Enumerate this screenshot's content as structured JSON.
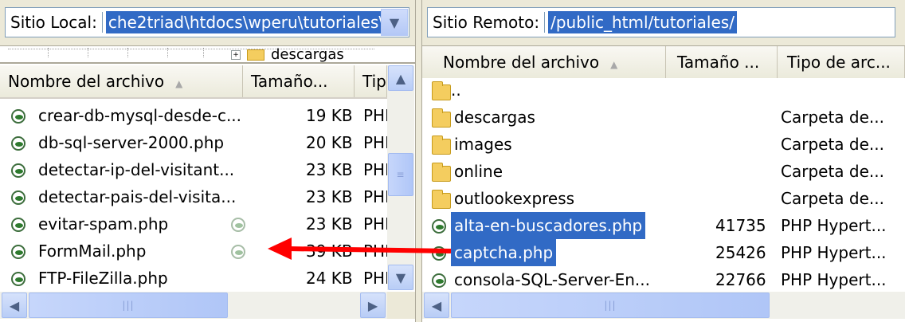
{
  "local": {
    "path_label": "Sitio Local:",
    "path_value": "che2triad\\htdocs\\wperu\\tutoriales\\",
    "tree_item": "descargas",
    "columns": [
      "Nombre del archivo",
      "Tamaño...",
      "Tipo"
    ],
    "files": [
      {
        "name": "crear-db-mysql-desde-c...",
        "size": "19 KB",
        "type": "PHP"
      },
      {
        "name": "db-sql-server-2000.php",
        "size": "20 KB",
        "type": "PHP"
      },
      {
        "name": "detectar-ip-del-visitant...",
        "size": "23 KB",
        "type": "PHP"
      },
      {
        "name": "detectar-pais-del-visita...",
        "size": "23 KB",
        "type": "PHP"
      },
      {
        "name": "evitar-spam.php",
        "size": "23 KB",
        "type": "PHP"
      },
      {
        "name": "FormMail.php",
        "size": "39 KB",
        "type": "PHP"
      },
      {
        "name": "FTP-FileZilla.php",
        "size": "24 KB",
        "type": "PHP"
      }
    ]
  },
  "remote": {
    "path_label": "Sitio Remoto:",
    "path_value": "/public_html/tutoriales/",
    "columns": [
      "Nombre del archivo",
      "Tamaño ...",
      "Tipo de arc..."
    ],
    "files": [
      {
        "name": "..",
        "kind": "folder",
        "size": "",
        "type": ""
      },
      {
        "name": "descargas",
        "kind": "folder",
        "size": "",
        "type": "Carpeta de..."
      },
      {
        "name": "images",
        "kind": "folder",
        "size": "",
        "type": "Carpeta de..."
      },
      {
        "name": "online",
        "kind": "folder",
        "size": "",
        "type": "Carpeta de..."
      },
      {
        "name": "outlookexpress",
        "kind": "folder",
        "size": "",
        "type": "Carpeta de..."
      },
      {
        "name": "alta-en-buscadores.php",
        "kind": "file",
        "size": "41735",
        "type": "PHP Hypert...",
        "selected": true
      },
      {
        "name": "captcha.php",
        "kind": "file",
        "size": "25426",
        "type": "PHP Hypert...",
        "selected": true
      },
      {
        "name": "consola-SQL-Server-En...",
        "kind": "file",
        "size": "22766",
        "type": "PHP Hypert..."
      }
    ]
  },
  "colors": {
    "selection": "#316ac5",
    "arrow": "#ff0000",
    "chrome": "#ece9d8"
  }
}
